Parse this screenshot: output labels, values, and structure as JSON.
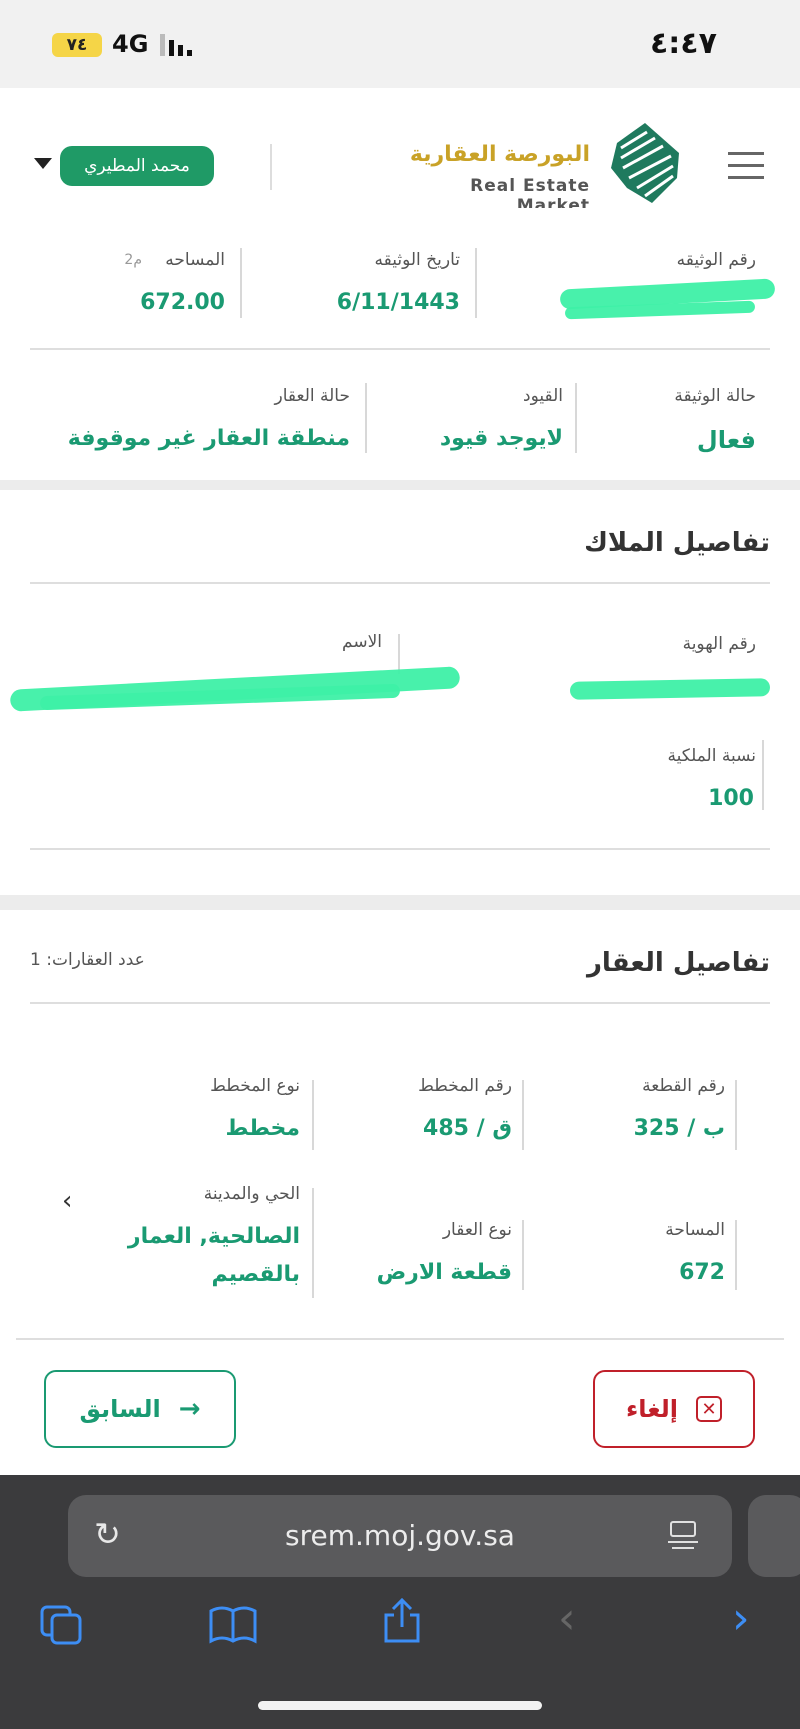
{
  "status": {
    "time": "٤:٤٧",
    "battery": "٧٤",
    "network": "4G"
  },
  "header": {
    "logo_ar": "البورصة العقارية",
    "logo_en": "Real Estate Market",
    "user_name": "محمد المطيري"
  },
  "deed": {
    "deed_number_label": "رقم الوثيقه",
    "deed_date_label": "تاريخ الوثيقه",
    "deed_date": "6/11/1443",
    "area_label": "المساحه",
    "area_unit": "م2",
    "area": "672.00",
    "status_label": "حالة الوثيقة",
    "status": "فعال",
    "restrictions_label": "القيود",
    "restrictions": "لايوجد قيود",
    "property_status_label": "حالة العقار",
    "property_status": "منطقة العقار غير موقوفة"
  },
  "owners": {
    "title": "تفاصيل الملاك",
    "id_label": "رقم الهوية",
    "name_label": "الاسم",
    "ownership_label": "نسبة الملكية",
    "ownership": "100"
  },
  "property": {
    "title": "تفاصيل العقار",
    "count_label": "عدد العقارات: 1",
    "plot_no_label": "رقم القطعة",
    "plot_no": "325 / ب",
    "plan_no_label": "رقم المخطط",
    "plan_no": "485 / ق",
    "plan_type_label": "نوع المخطط",
    "plan_type": "مخطط",
    "area_label": "المساحة",
    "area": "672",
    "type_label": "نوع العقار",
    "type": "قطعة الارض",
    "district_label": "الحي والمدينة",
    "district_line1": "الصالحية, العمار",
    "district_line2": "بالقصيم"
  },
  "buttons": {
    "cancel": "إلغاء",
    "previous": "السابق"
  },
  "browser": {
    "url": "srem.moj.gov.sa"
  },
  "colors": {
    "accent": "#1a9a72",
    "cancel": "#c0202a",
    "logo_gold": "#c9a227"
  }
}
